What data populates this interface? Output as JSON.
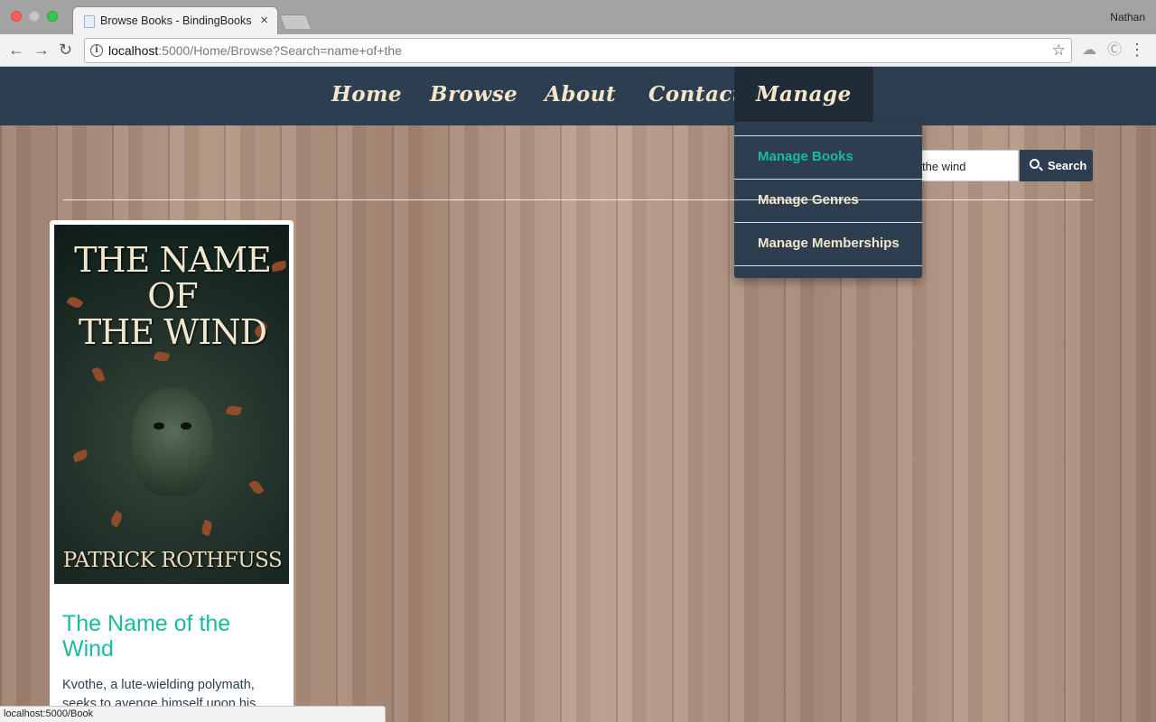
{
  "browser": {
    "tab_title": "Browse Books - BindingBooks",
    "tab_close": "×",
    "profile_name": "Nathan",
    "url_host": "localhost",
    "url_rest": ":5000/Home/Browse?Search=name+of+the",
    "status_url": "localhost:5000/Book",
    "icons": [
      "back-icon",
      "forward-icon",
      "reload-icon",
      "info-icon",
      "star-icon",
      "menu-icon"
    ]
  },
  "nav": {
    "items": [
      {
        "label": "Home"
      },
      {
        "label": "Browse"
      },
      {
        "label": "About"
      },
      {
        "label": "Contact"
      },
      {
        "label": "Manage"
      }
    ],
    "active": "Manage"
  },
  "manage_menu": {
    "items": [
      {
        "label": "Manage Books"
      },
      {
        "label": "Manage Genres"
      },
      {
        "label": "Manage Memberships"
      }
    ],
    "hovered": "Manage Books"
  },
  "search": {
    "value": "the wind",
    "button_label": "Search"
  },
  "results": [
    {
      "cover_title_line1": "THE NAME OF",
      "cover_title_line2": "THE WIND",
      "cover_author": "PATRICK ROTHFUSS",
      "title": "The Name of the Wind",
      "description": "Kvothe, a lute-wielding polymath, seeks to avenge himself upon his"
    }
  ],
  "colors": {
    "nav_bg": "#2c3e50",
    "nav_text": "#f4e6c8",
    "accent": "#18bc9c"
  }
}
